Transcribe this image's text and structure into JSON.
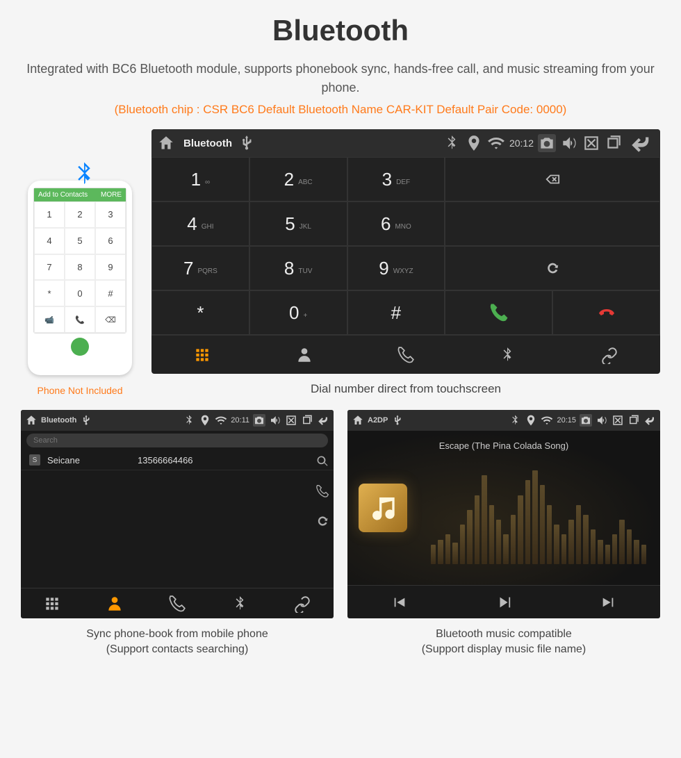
{
  "header": {
    "title": "Bluetooth",
    "subtitle": "Integrated with BC6 Bluetooth module, supports phonebook sync, hands-free call, and music streaming from your phone.",
    "specs": "(Bluetooth chip : CSR BC6    Default Bluetooth Name CAR-KIT    Default Pair Code: 0000)"
  },
  "phone": {
    "add_contacts": "Add to Contacts",
    "more": "MORE",
    "note": "Phone Not Included",
    "keys": [
      "1",
      "2",
      "3",
      "4",
      "5",
      "6",
      "7",
      "8",
      "9",
      "*",
      "0",
      "#"
    ]
  },
  "dialer": {
    "status": {
      "title": "Bluetooth",
      "time": "20:12"
    },
    "keys": [
      {
        "n": "1",
        "l": "∞"
      },
      {
        "n": "2",
        "l": "ABC"
      },
      {
        "n": "3",
        "l": "DEF"
      },
      {
        "n": "4",
        "l": "GHI"
      },
      {
        "n": "5",
        "l": "JKL"
      },
      {
        "n": "6",
        "l": "MNO"
      },
      {
        "n": "7",
        "l": "PQRS"
      },
      {
        "n": "8",
        "l": "TUV"
      },
      {
        "n": "9",
        "l": "WXYZ"
      },
      {
        "n": "*",
        "l": ""
      },
      {
        "n": "0",
        "l": "+"
      },
      {
        "n": "#",
        "l": ""
      }
    ],
    "caption": "Dial number direct from touchscreen"
  },
  "phonebook": {
    "status": {
      "title": "Bluetooth",
      "time": "20:11"
    },
    "search_placeholder": "Search",
    "contacts": [
      {
        "badge": "S",
        "name": "Seicane",
        "number": "13566664466"
      }
    ],
    "caption_line1": "Sync phone-book from mobile phone",
    "caption_line2": "(Support contacts searching)"
  },
  "music": {
    "status": {
      "title": "A2DP",
      "time": "20:15"
    },
    "song": "Escape (The Pina Colada Song)",
    "caption_line1": "Bluetooth music compatible",
    "caption_line2": "(Support display music file name)"
  }
}
